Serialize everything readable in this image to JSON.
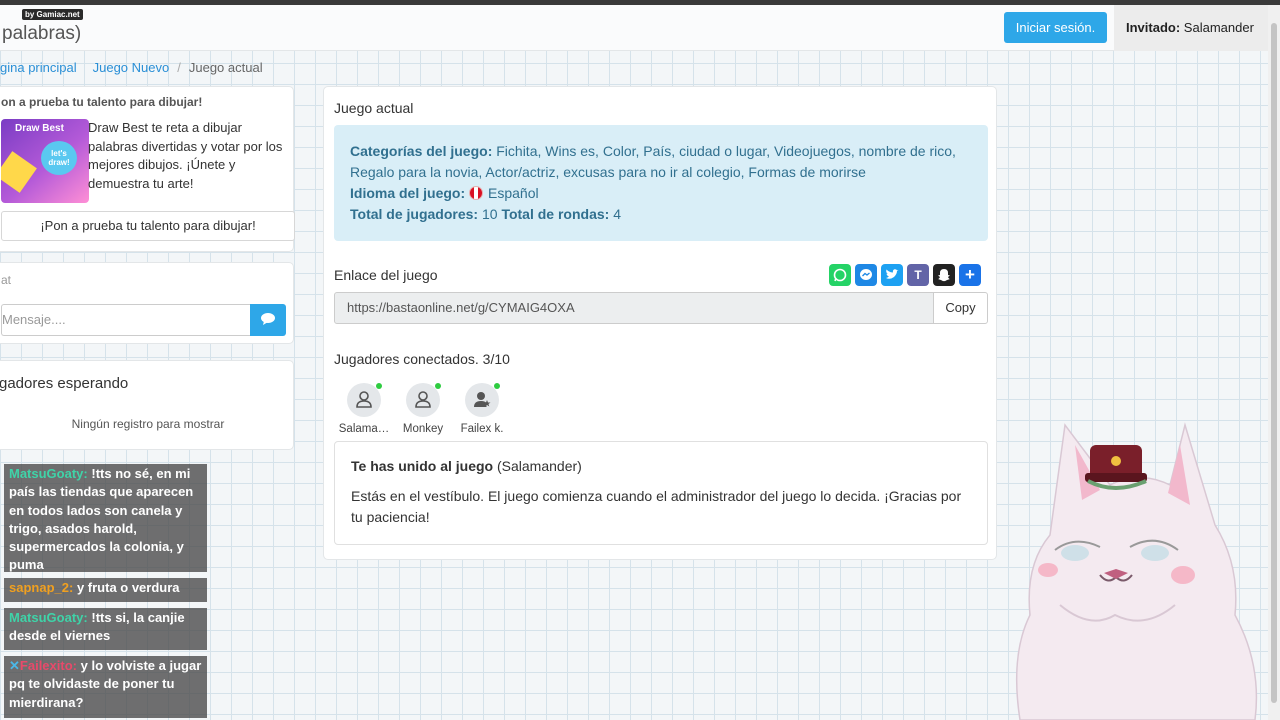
{
  "navbar": {
    "badge": "by Gamiac.net",
    "brand": "palabras)",
    "login_label": "Iniciar sesión.",
    "guest_label": "Invitado:",
    "guest_name": "Salamander"
  },
  "breadcrumb": [
    "gina principal",
    "Juego Nuevo",
    "Juego actual"
  ],
  "ad": {
    "heading": "on a prueba tu talento para dibujar!",
    "thumb_title": "Draw Best",
    "thumb_bubble": "let's draw!",
    "text": "Draw Best te reta a dibujar palabras divertidas y votar por los mejores dibujos. ¡Únete y demuestra tu arte!",
    "button": "¡Pon a prueba tu talento para dibujar!"
  },
  "chat": {
    "title": "at",
    "placeholder": "Mensaje...."
  },
  "waiting": {
    "title": "gadores esperando",
    "empty": "Ningún registro para mostrar"
  },
  "game": {
    "title": "Juego actual",
    "categories_label": "Categorías del juego:",
    "categories": "Fichita, Wins es, Color, País, ciudad o lugar, Videojuegos, nombre de rico, Regalo para la novia, Actor/actriz, excusas para no ir al colegio, Formas de morirse",
    "language_label": "Idioma del juego:",
    "language": "Español",
    "players_total_label": "Total de jugadores:",
    "players_total": "10",
    "rounds_total_label": "Total de rondas:",
    "rounds_total": "4",
    "link_label": "Enlace del juego",
    "link_url": "https://bastaonline.net/g/CYMAIG4OXA",
    "copy_label": "Copy",
    "players_connected_label": "Jugadores conectados. 3/10",
    "players": [
      {
        "name": "Salama…"
      },
      {
        "name": "Monkey"
      },
      {
        "name": "Failex k."
      }
    ],
    "joined_title": "Te has unido al juego",
    "joined_name": "(Salamander)",
    "joined_body": "Estás en el vestíbulo. El juego comienza cuando el administrador del juego lo decida. ¡Gracias por tu paciencia!"
  },
  "share_icons": [
    {
      "name": "whatsapp",
      "color": "#25d366"
    },
    {
      "name": "messenger",
      "color": "#1e88e5"
    },
    {
      "name": "twitter",
      "color": "#1da1f2"
    },
    {
      "name": "teams",
      "color": "#6264a7"
    },
    {
      "name": "snapchat",
      "color": "#222222"
    },
    {
      "name": "share-plus",
      "color": "#1a73e8"
    }
  ],
  "stream_chat": [
    {
      "user": "MatsuGoaty:",
      "user_color": "#3fd3a8",
      "text": "!tts no sé, en mi país las tiendas que aparecen en todos lados son canela y trigo, asados harold, supermercados la colonia, y puma"
    },
    {
      "user": "sapnap_2:",
      "user_color": "#f0a020",
      "text": "y fruta o verdura"
    },
    {
      "user": "MatsuGoaty:",
      "user_color": "#3fd3a8",
      "text": "!tts si, la canjie desde el viernes"
    },
    {
      "user": "Failexito:",
      "user_color": "#e84a6a",
      "text": "y lo volviste a jugar pq te olvidaste de poner tu mierdirana?"
    }
  ]
}
